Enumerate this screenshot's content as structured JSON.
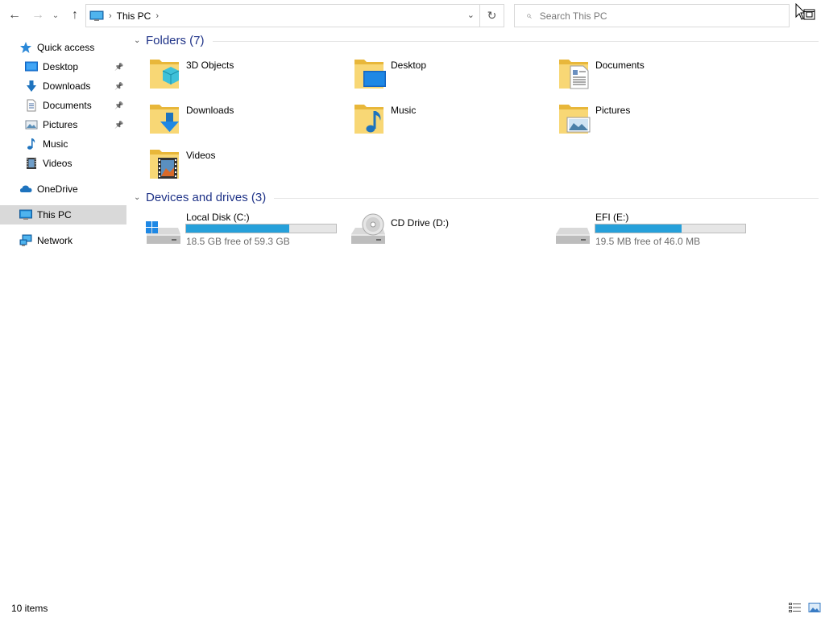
{
  "toolbar": {
    "back_icon": "←",
    "forward_icon": "→",
    "recent_icon": "⌄",
    "up_icon": "↑"
  },
  "address": {
    "separator": "›",
    "crumb": "This PC",
    "dropdown_icon": "⌄",
    "refresh_icon": "↻"
  },
  "search": {
    "placeholder": "Search This PC",
    "icon": "⌕"
  },
  "navpane": {
    "pin_glyph": "📌",
    "quick_access": "Quick access",
    "quick_items": [
      {
        "label": "Desktop",
        "pinned": true
      },
      {
        "label": "Downloads",
        "pinned": true
      },
      {
        "label": "Documents",
        "pinned": true
      },
      {
        "label": "Pictures",
        "pinned": true
      },
      {
        "label": "Music",
        "pinned": false
      },
      {
        "label": "Videos",
        "pinned": false
      }
    ],
    "onedrive": "OneDrive",
    "this_pc": "This PC",
    "network": "Network"
  },
  "content": {
    "collapse_icon": "⌄",
    "folders_header": "Folders (7)",
    "folders": [
      {
        "name": "3D Objects"
      },
      {
        "name": "Desktop"
      },
      {
        "name": "Documents"
      },
      {
        "name": "Downloads"
      },
      {
        "name": "Music"
      },
      {
        "name": "Pictures"
      },
      {
        "name": "Videos"
      }
    ],
    "drives_header": "Devices and drives (3)",
    "drives": [
      {
        "name": "Local Disk (C:)",
        "free_text": "18.5 GB free of 59.3 GB",
        "used_fraction": 0.688
      },
      {
        "name": "CD Drive (D:)",
        "free_text": "",
        "used_fraction": null
      },
      {
        "name": "EFI (E:)",
        "free_text": "19.5 MB free of 46.0 MB",
        "used_fraction": 0.576
      }
    ]
  },
  "statusbar": {
    "item_count": "10 items"
  },
  "colors": {
    "accent_blue": "#26a0da",
    "header_blue": "#1e3287",
    "folder_yellow": "#f8d775",
    "folder_dark": "#e8b73a",
    "selected_bg": "#d9d9d9"
  }
}
